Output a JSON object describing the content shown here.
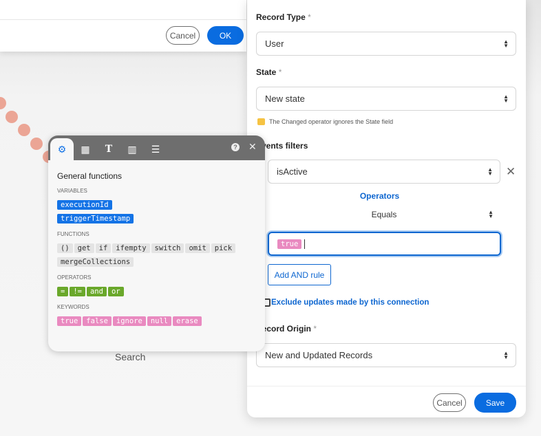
{
  "top_dialog": {
    "cancel": "Cancel",
    "ok": "OK"
  },
  "canvas": {
    "search_label": "Search"
  },
  "panel": {
    "record_type": {
      "label": "Record Type",
      "value": "User"
    },
    "state": {
      "label": "State",
      "value": "New state",
      "note": "The Changed operator ignores the State field"
    },
    "events_filters": {
      "label": "Events filters",
      "field": "isActive",
      "operators_label": "Operators",
      "operator": "Equals",
      "value_chip": "true",
      "add_rule": "Add AND rule"
    },
    "exclude_label": "Exclude updates made by this connection",
    "record_origin": {
      "label": "Record Origin",
      "value": "New and Updated Records"
    },
    "required_mark": "*",
    "cancel": "Cancel",
    "save": "Save"
  },
  "popover": {
    "title": "General functions",
    "variables_label": "VARIABLES",
    "variables": [
      "executionId",
      "triggerTimestamp"
    ],
    "functions_label": "FUNCTIONS",
    "functions": [
      "()",
      "get",
      "if",
      "ifempty",
      "switch",
      "omit",
      "pick",
      "mergeCollections"
    ],
    "operators_label": "OPERATORS",
    "operators": [
      "=",
      "!=",
      "and",
      "or"
    ],
    "keywords_label": "KEYWORDS",
    "keywords": [
      "true",
      "false",
      "ignore",
      "null",
      "erase"
    ]
  }
}
